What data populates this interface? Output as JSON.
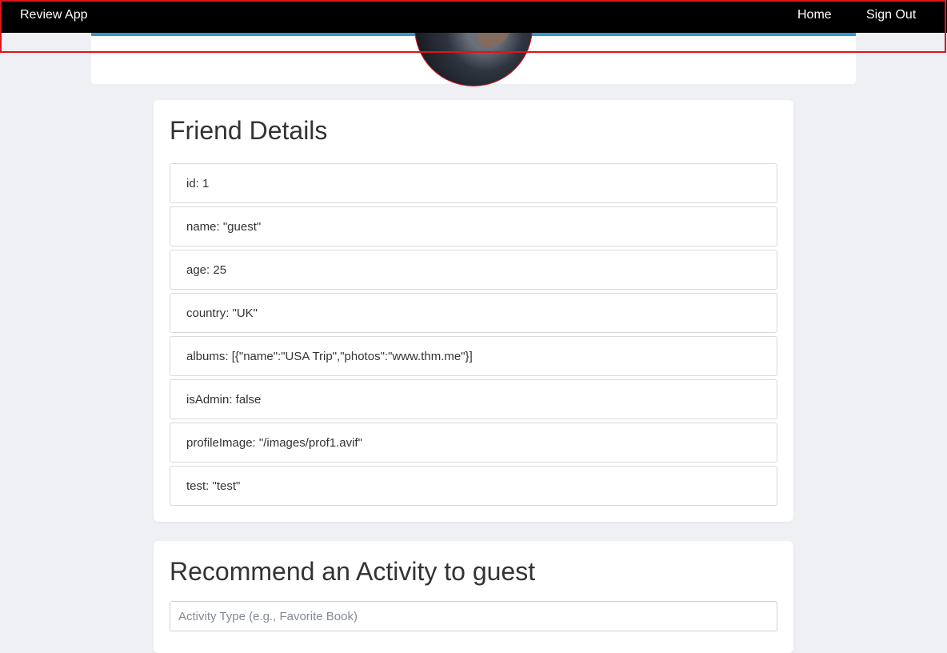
{
  "navbar": {
    "brand": "Review App",
    "links": {
      "home": "Home",
      "sign_out": "Sign Out"
    }
  },
  "details": {
    "title": "Friend Details",
    "rows": [
      "id: 1",
      "name: \"guest\"",
      "age: 25",
      "country: \"UK\"",
      "albums: [{\"name\":\"USA Trip\",\"photos\":\"www.thm.me\"}]",
      "isAdmin: false",
      "profileImage: \"/images/prof1.avif\"",
      "test: \"test\""
    ]
  },
  "recommend": {
    "title": "Recommend an Activity to guest",
    "activity_placeholder": "Activity Type (e.g., Favorite Book)"
  },
  "colors": {
    "navbar_bg": "#000000",
    "highlight_outline": "#e0141a",
    "accent_bar": "#3399cc",
    "page_bg": "#eff0f4"
  }
}
